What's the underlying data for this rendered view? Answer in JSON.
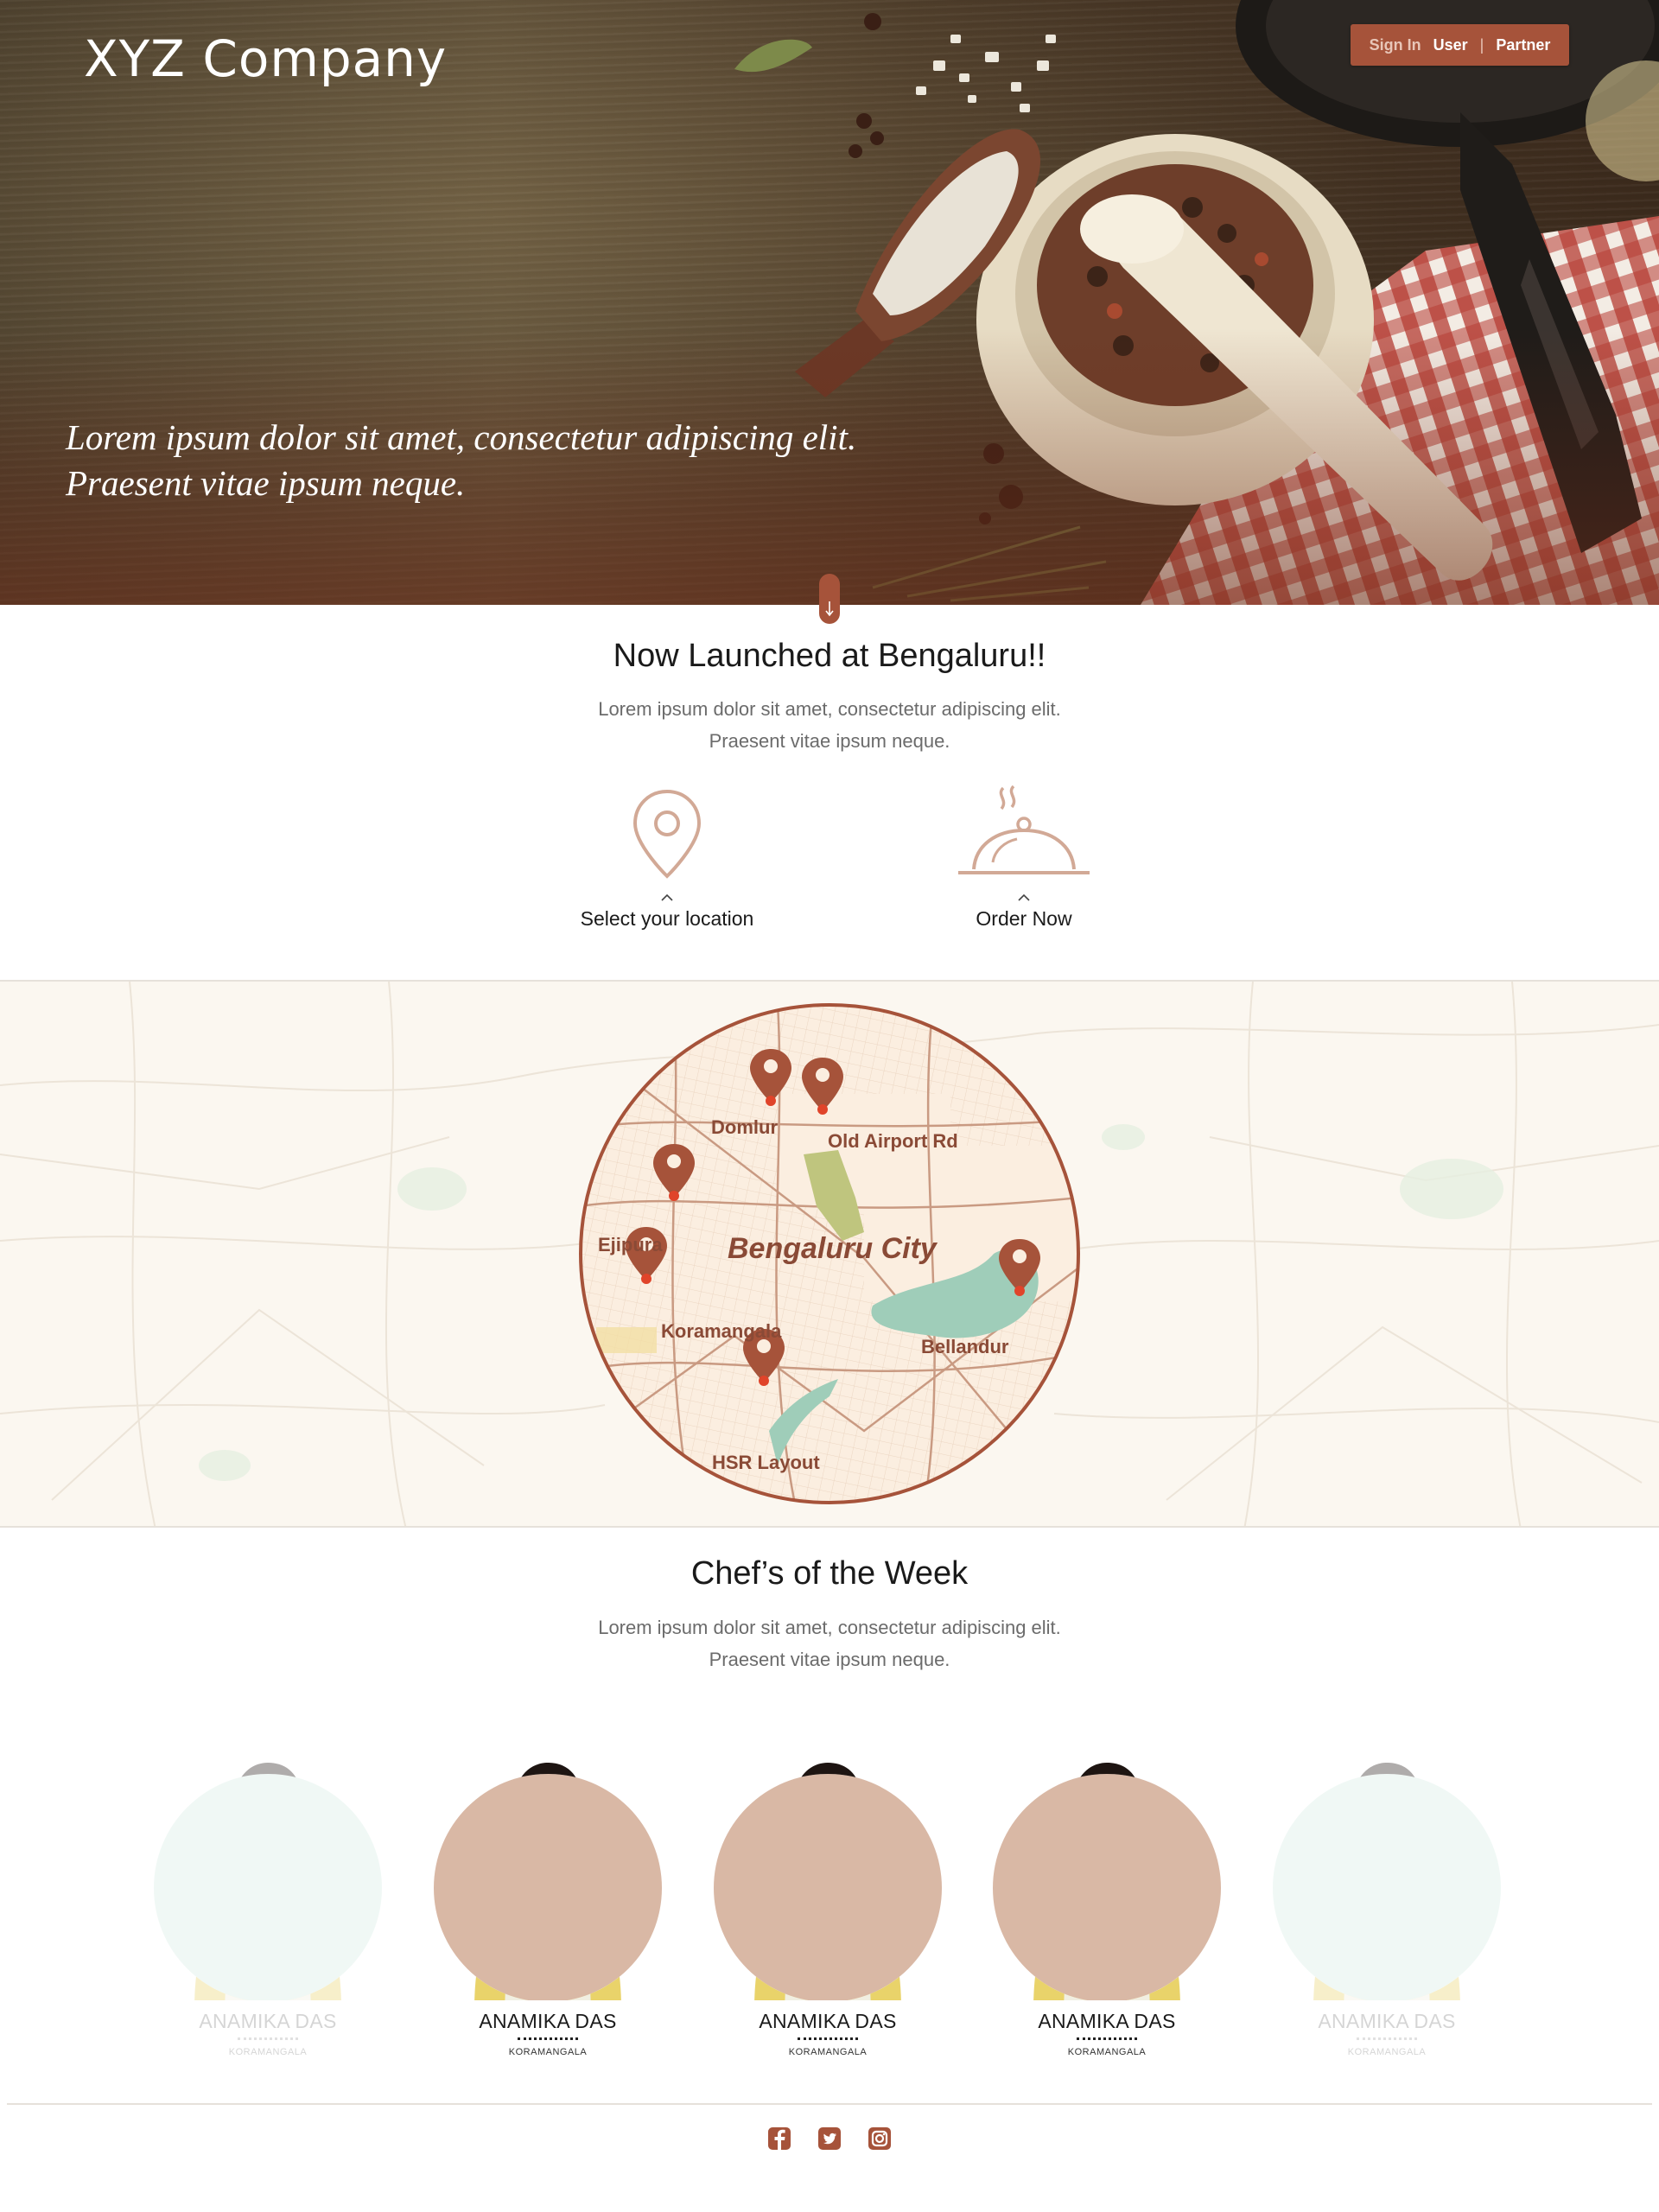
{
  "header": {
    "brand": "XYZ Company",
    "auth": {
      "sign_in": "Sign In",
      "user": "User",
      "separator": "|",
      "partner": "Partner"
    },
    "tagline_line1": "Lorem ipsum dolor sit amet, consectetur adipiscing elit.",
    "tagline_line2": "Praesent vitae ipsum neque."
  },
  "launch": {
    "title": "Now Launched at Bengaluru!!",
    "subtitle_line1": "Lorem ipsum dolor sit amet, consectetur adipiscing elit.",
    "subtitle_line2": "Praesent vitae ipsum neque.",
    "features": [
      {
        "label": "Select your location",
        "icon": "location-pin-icon"
      },
      {
        "label": "Order Now",
        "icon": "cloche-icon"
      }
    ]
  },
  "map": {
    "city": "Bengaluru City",
    "locations": [
      "Domlur",
      "Old Airport Rd",
      "Ejipura",
      "Koramangala",
      "Bellandur",
      "HSR Layout"
    ]
  },
  "chefs": {
    "title": "Chef’s of the Week",
    "subtitle_line1": "Lorem ipsum dolor sit amet, consectetur adipiscing elit.",
    "subtitle_line2": "Praesent vitae ipsum neque.",
    "items": [
      {
        "name": "ANAMIKA DAS",
        "location": "KORAMANGALA"
      },
      {
        "name": "ANAMIKA DAS",
        "location": "KORAMANGALA"
      },
      {
        "name": "ANAMIKA DAS",
        "location": "KORAMANGALA"
      },
      {
        "name": "ANAMIKA DAS",
        "location": "KORAMANGALA"
      },
      {
        "name": "ANAMIKA DAS",
        "location": "KORAMANGALA"
      }
    ]
  },
  "footer": {
    "social": [
      "facebook-icon",
      "twitter-icon",
      "instagram-icon"
    ]
  },
  "colors": {
    "accent": "#a6533a",
    "map_accent": "#8a4a36",
    "chef_bg_active": "#d9b8a5",
    "chef_bg_faded": "#d6ece4"
  }
}
